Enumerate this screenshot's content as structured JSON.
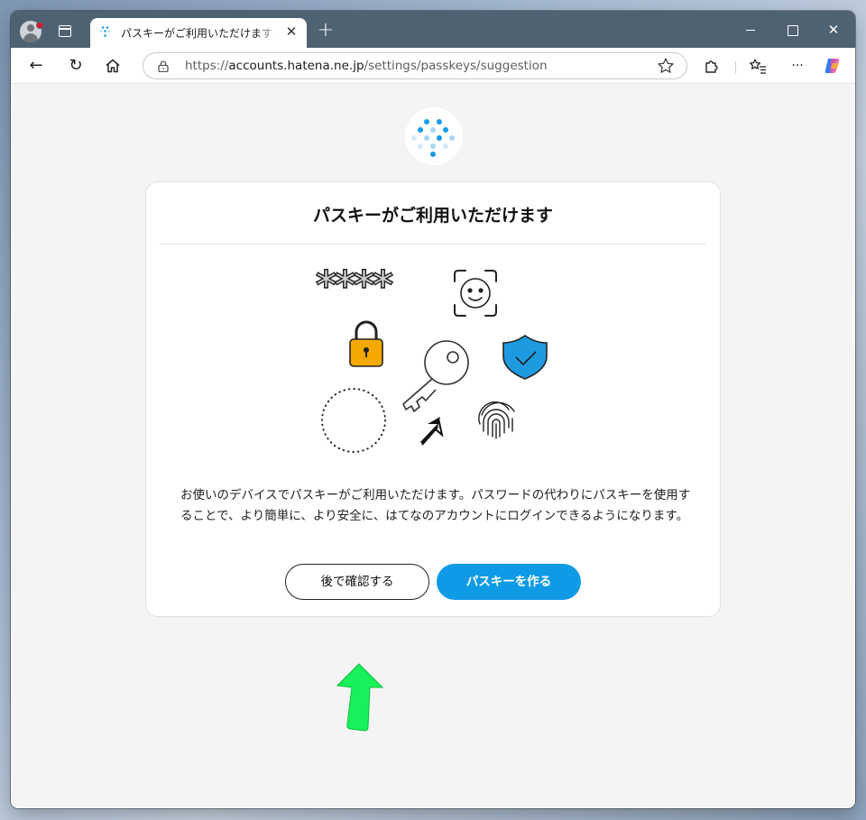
{
  "browser": {
    "tab_title": "パスキーがご利用いただけます - はてな",
    "tab_close": "✕",
    "new_tab": "+",
    "close": "✕",
    "address": {
      "scheme": "https://",
      "host": "accounts.hatena.ne.jp",
      "path": "/settings/passkeys/suggestion"
    },
    "toolbar_glyphs": {
      "back": "←",
      "refresh": "↻",
      "more": "···"
    }
  },
  "page": {
    "title": "パスキーがご利用いただけます",
    "description": "お使いのデバイスでパスキーがご利用いただけます。パスワードの代わりにパスキーを使用することで、より簡単に、より安全に、はてなのアカウントにログインできるようになります。",
    "password_mask": "****",
    "later_button": "後で確認する",
    "create_button": "パスキーを作る"
  },
  "colors": {
    "accent": "#0f9ae6",
    "lock": "#f5a800",
    "shield": "#1e9be0",
    "titlebar": "#4f6272",
    "annotation_arrow": "#19f05a"
  }
}
